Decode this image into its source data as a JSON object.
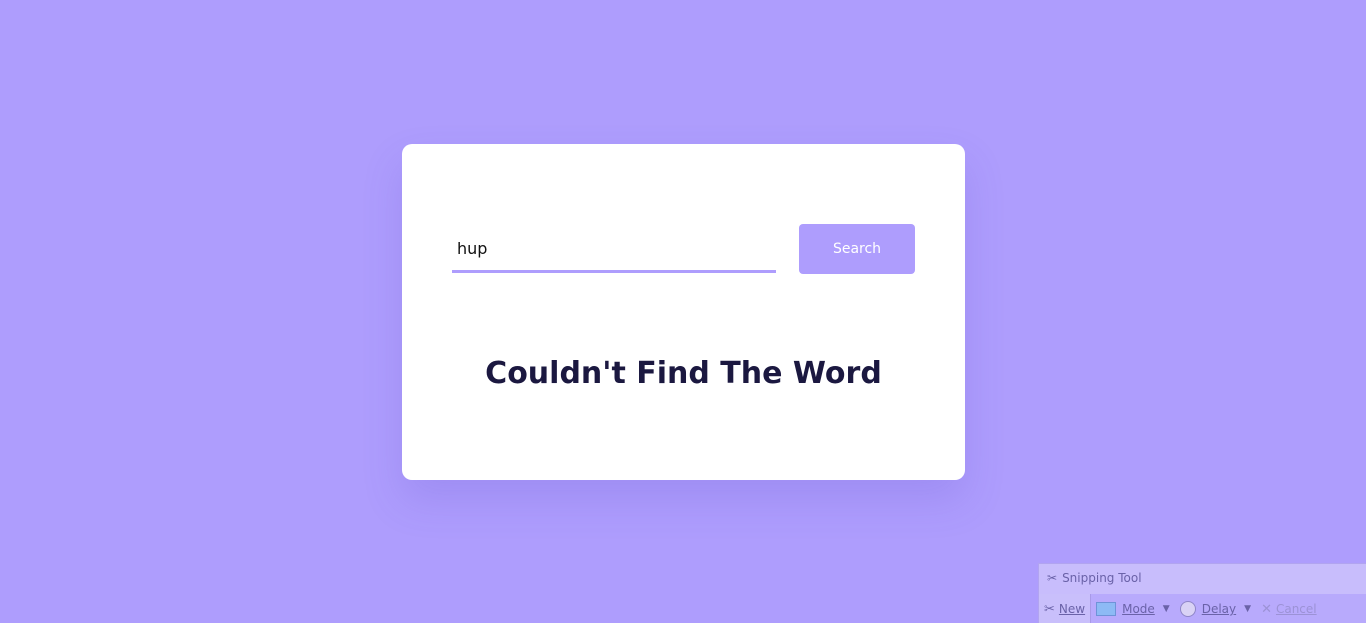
{
  "search": {
    "value": "hup",
    "button_label": "Search"
  },
  "result": {
    "message": "Couldn't Find The Word"
  },
  "snipping_tool": {
    "title": "Snipping Tool",
    "toolbar": {
      "new_label": "New",
      "mode_label": "Mode",
      "delay_label": "Delay",
      "cancel_label": "Cancel"
    }
  },
  "colors": {
    "background": "#ae9dfd",
    "card": "#ffffff",
    "accent": "#ae9dfd",
    "heading": "#1b1840"
  }
}
